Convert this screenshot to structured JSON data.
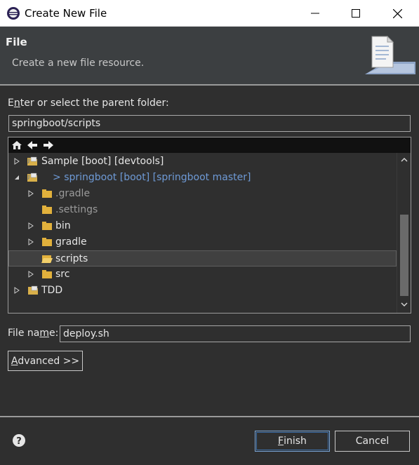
{
  "window": {
    "title": "Create New File",
    "app_icon": "eclipse-icon"
  },
  "banner": {
    "title": "File",
    "description": "Create a new file resource.",
    "image": "new-file-wizard-icon"
  },
  "parent_folder": {
    "label_before": "E",
    "label_mnemonic": "n",
    "label_after": "ter or select the parent folder:",
    "value": "springboot/scripts"
  },
  "tree": {
    "toolbar": [
      "home-icon",
      "back-arrow-icon",
      "forward-arrow-icon"
    ],
    "rows": [
      {
        "label": "Sample [boot] [devtools]",
        "prefix": "",
        "expanded": false,
        "icon": "project-icon"
      },
      {
        "label": "springboot [boot] [springboot master]",
        "prefix": "> ",
        "expanded": true,
        "icon": "project-icon"
      },
      {
        "label": ".gradle",
        "expanded": false,
        "icon": "folder-icon"
      },
      {
        "label": ".settings",
        "expanded": null,
        "icon": "folder-icon"
      },
      {
        "label": "bin",
        "expanded": false,
        "icon": "folder-icon"
      },
      {
        "label": "gradle",
        "expanded": false,
        "icon": "folder-icon"
      },
      {
        "label": "scripts",
        "expanded": null,
        "icon": "folder-open-icon",
        "selected": true
      },
      {
        "label": "src",
        "expanded": false,
        "icon": "folder-icon"
      },
      {
        "label": "TDD",
        "expanded": false,
        "icon": "project-icon"
      }
    ]
  },
  "file_name": {
    "label_before": "File na",
    "label_mnemonic": "m",
    "label_after": "e:",
    "value": "deploy.sh"
  },
  "buttons": {
    "advanced": {
      "mnemonic": "A",
      "rest": "dvanced >>"
    },
    "finish": {
      "mnemonic": "F",
      "rest": "inish"
    },
    "cancel": "Cancel"
  }
}
